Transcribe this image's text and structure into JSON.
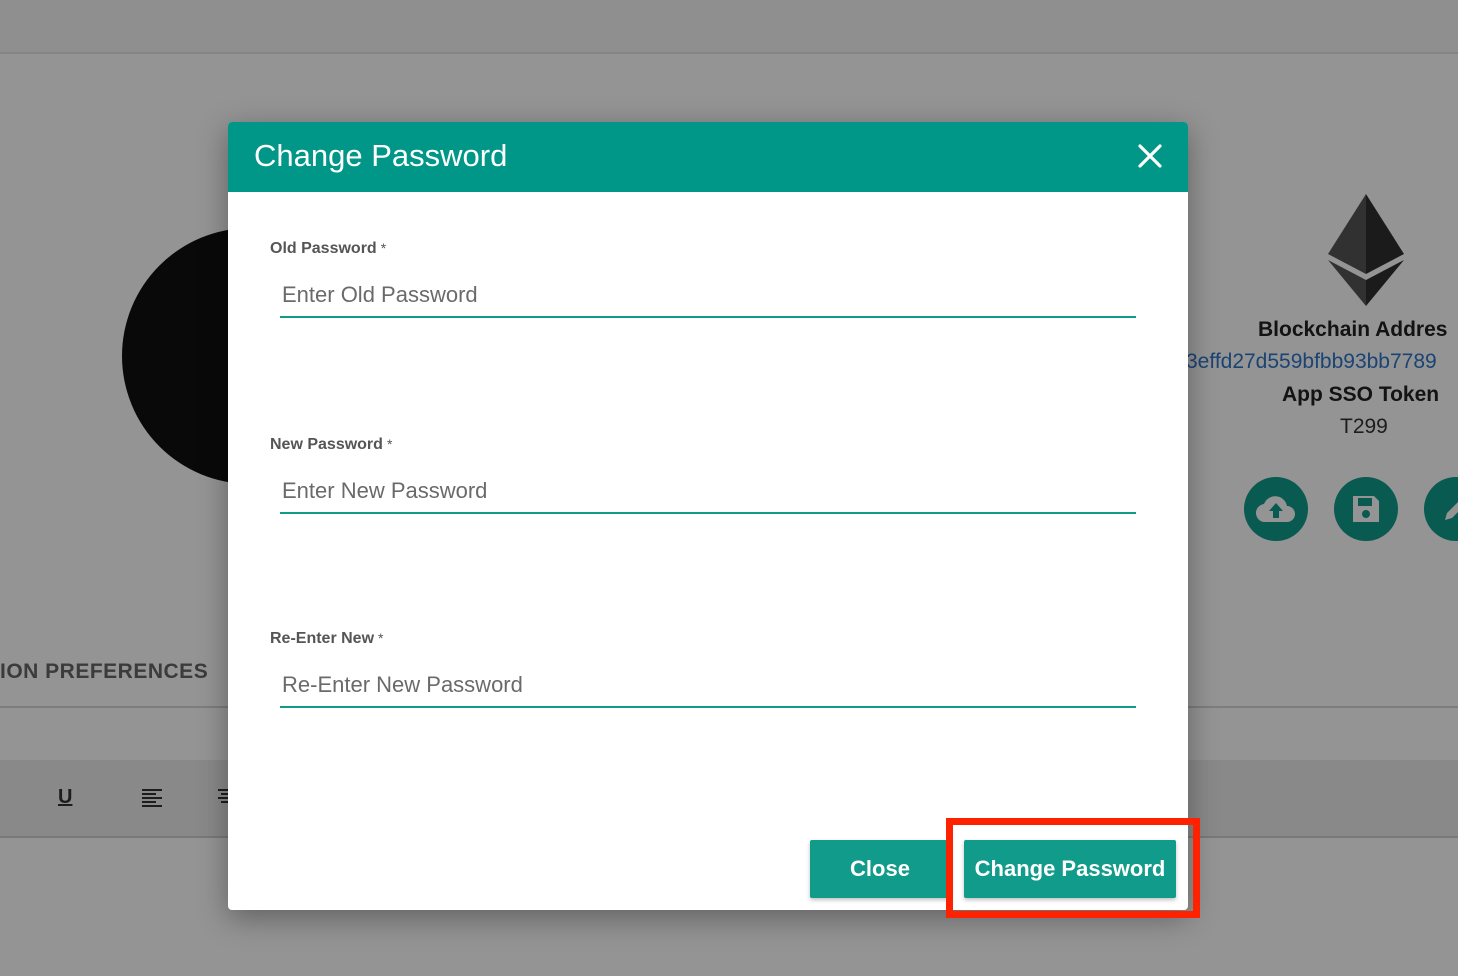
{
  "background": {
    "blockchain_label": "Blockchain Addres",
    "blockchain_value": "3effd27d559bfbb93bb7789",
    "sso_label": "App SSO Token",
    "sso_value": "T299",
    "prefs_label": "ION PREFERENCES",
    "toolbar": {
      "underline": "U"
    },
    "icons": [
      "ethereum-icon",
      "cloud-upload-icon",
      "save-icon",
      "edit-icon"
    ]
  },
  "modal": {
    "title": "Change Password",
    "fields": [
      {
        "label": "Old Password",
        "required": "*",
        "placeholder": "Enter Old Password",
        "value": ""
      },
      {
        "label": "New Password",
        "required": "*",
        "placeholder": "Enter New Password",
        "value": ""
      },
      {
        "label": "Re-Enter New",
        "required": "*",
        "placeholder": "Re-Enter New Password",
        "value": ""
      }
    ],
    "close_label": "Close",
    "submit_label": "Change Password"
  },
  "colors": {
    "accent": "#009688",
    "button": "#119b8a",
    "highlight": "#ff2200",
    "link": "#2e75c9"
  }
}
